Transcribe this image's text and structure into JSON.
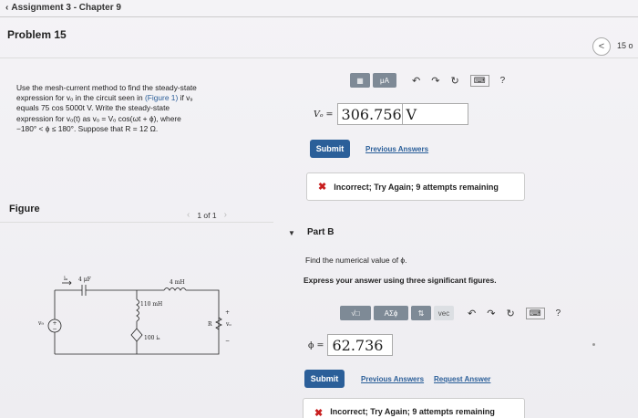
{
  "header": {
    "back_label": "Assignment 3 - Chapter 9",
    "problem_title": "Problem 15",
    "page_count": "15 o"
  },
  "problem": {
    "statement_parts": [
      "Use the mesh-current method to find the steady-state",
      "expression for vₒ in the circuit seen in ",
      "(Figure 1)",
      " if v₉",
      "equals 75 cos 5000t  V. Write the steady-state",
      "expression for vₒ(t) as vₒ = Vₒ cos(ωt + ϕ), where",
      "−180°  < ϕ ≤ 180°. Suppose that R = 12 Ω."
    ]
  },
  "figure": {
    "label": "Figure",
    "pager": "1 of 1",
    "components": {
      "capacitor": "4 μF",
      "inductor_top": "4 mH",
      "inductor_mid": "110 mH",
      "source_dep": "100 iₐ",
      "resistor": "R",
      "vo": "vₒ",
      "vg": "v₉",
      "ia": "iₐ",
      "plus": "+",
      "minus": "−"
    }
  },
  "partA": {
    "toolbar_label_mu": "μA",
    "variable": "Vₒ =",
    "answer": "306.756",
    "unit": "V",
    "submit_label": "Submit",
    "previous_answers": "Previous Answers",
    "feedback": "Incorrect; Try Again; 9 attempts remaining"
  },
  "partB": {
    "title": "Part B",
    "find_text": "Find the numerical value of ϕ.",
    "express_text": "Express your answer using three significant figures.",
    "toolbar": {
      "sqrt_label": "√□",
      "greek_label": "AΣϕ",
      "arrows_label": "⇅",
      "vec_label": "vec"
    },
    "variable": "ϕ =",
    "answer": "62.736",
    "submit_label": "Submit",
    "previous_answers": "Previous Answers",
    "request_answer": "Request Answer",
    "feedback": "Incorrect; Try Again; 9 attempts remaining"
  },
  "icons": {
    "undo": "undo-icon",
    "redo": "redo-icon",
    "reset": "reset-icon",
    "keyboard": "keyboard-icon",
    "help": "help-icon"
  },
  "colors": {
    "submit": "#2b5f99",
    "error": "#c81e1e",
    "toolbar": "#7e8a96"
  }
}
